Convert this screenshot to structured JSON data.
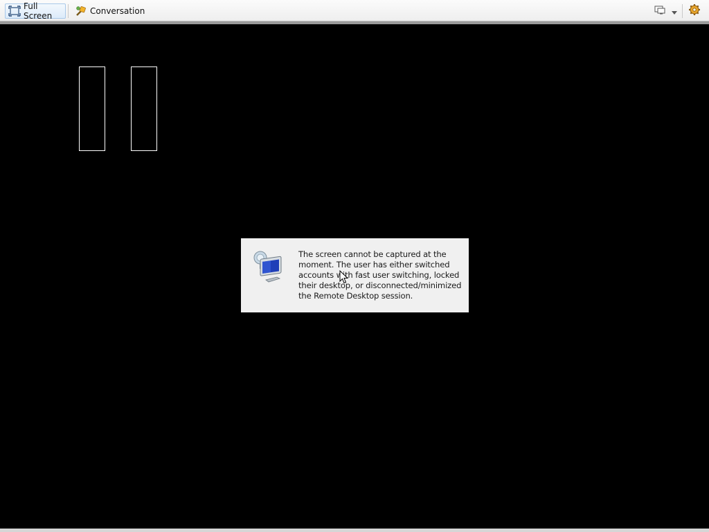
{
  "toolbar": {
    "full_screen_label": "Full Screen",
    "conversation_label": "Conversation",
    "icons": {
      "full_screen": "fullscreen-icon",
      "conversation": "conversation-icon",
      "display_switch": "monitor-icon",
      "dropdown": "chevron-down-icon",
      "settings": "gear-icon"
    }
  },
  "notice": {
    "icon": "remote-desktop-monitor-icon",
    "message": "The screen cannot be captured at the moment. The user has either switched accounts with fast user switching, locked their desktop, or disconnected/minimized the Remote Desktop session."
  },
  "colors": {
    "remote_background": "#000000",
    "notice_background": "#f0f0f0",
    "active_button_bg": "#dcebfa",
    "active_button_border": "#a8c8ea"
  }
}
